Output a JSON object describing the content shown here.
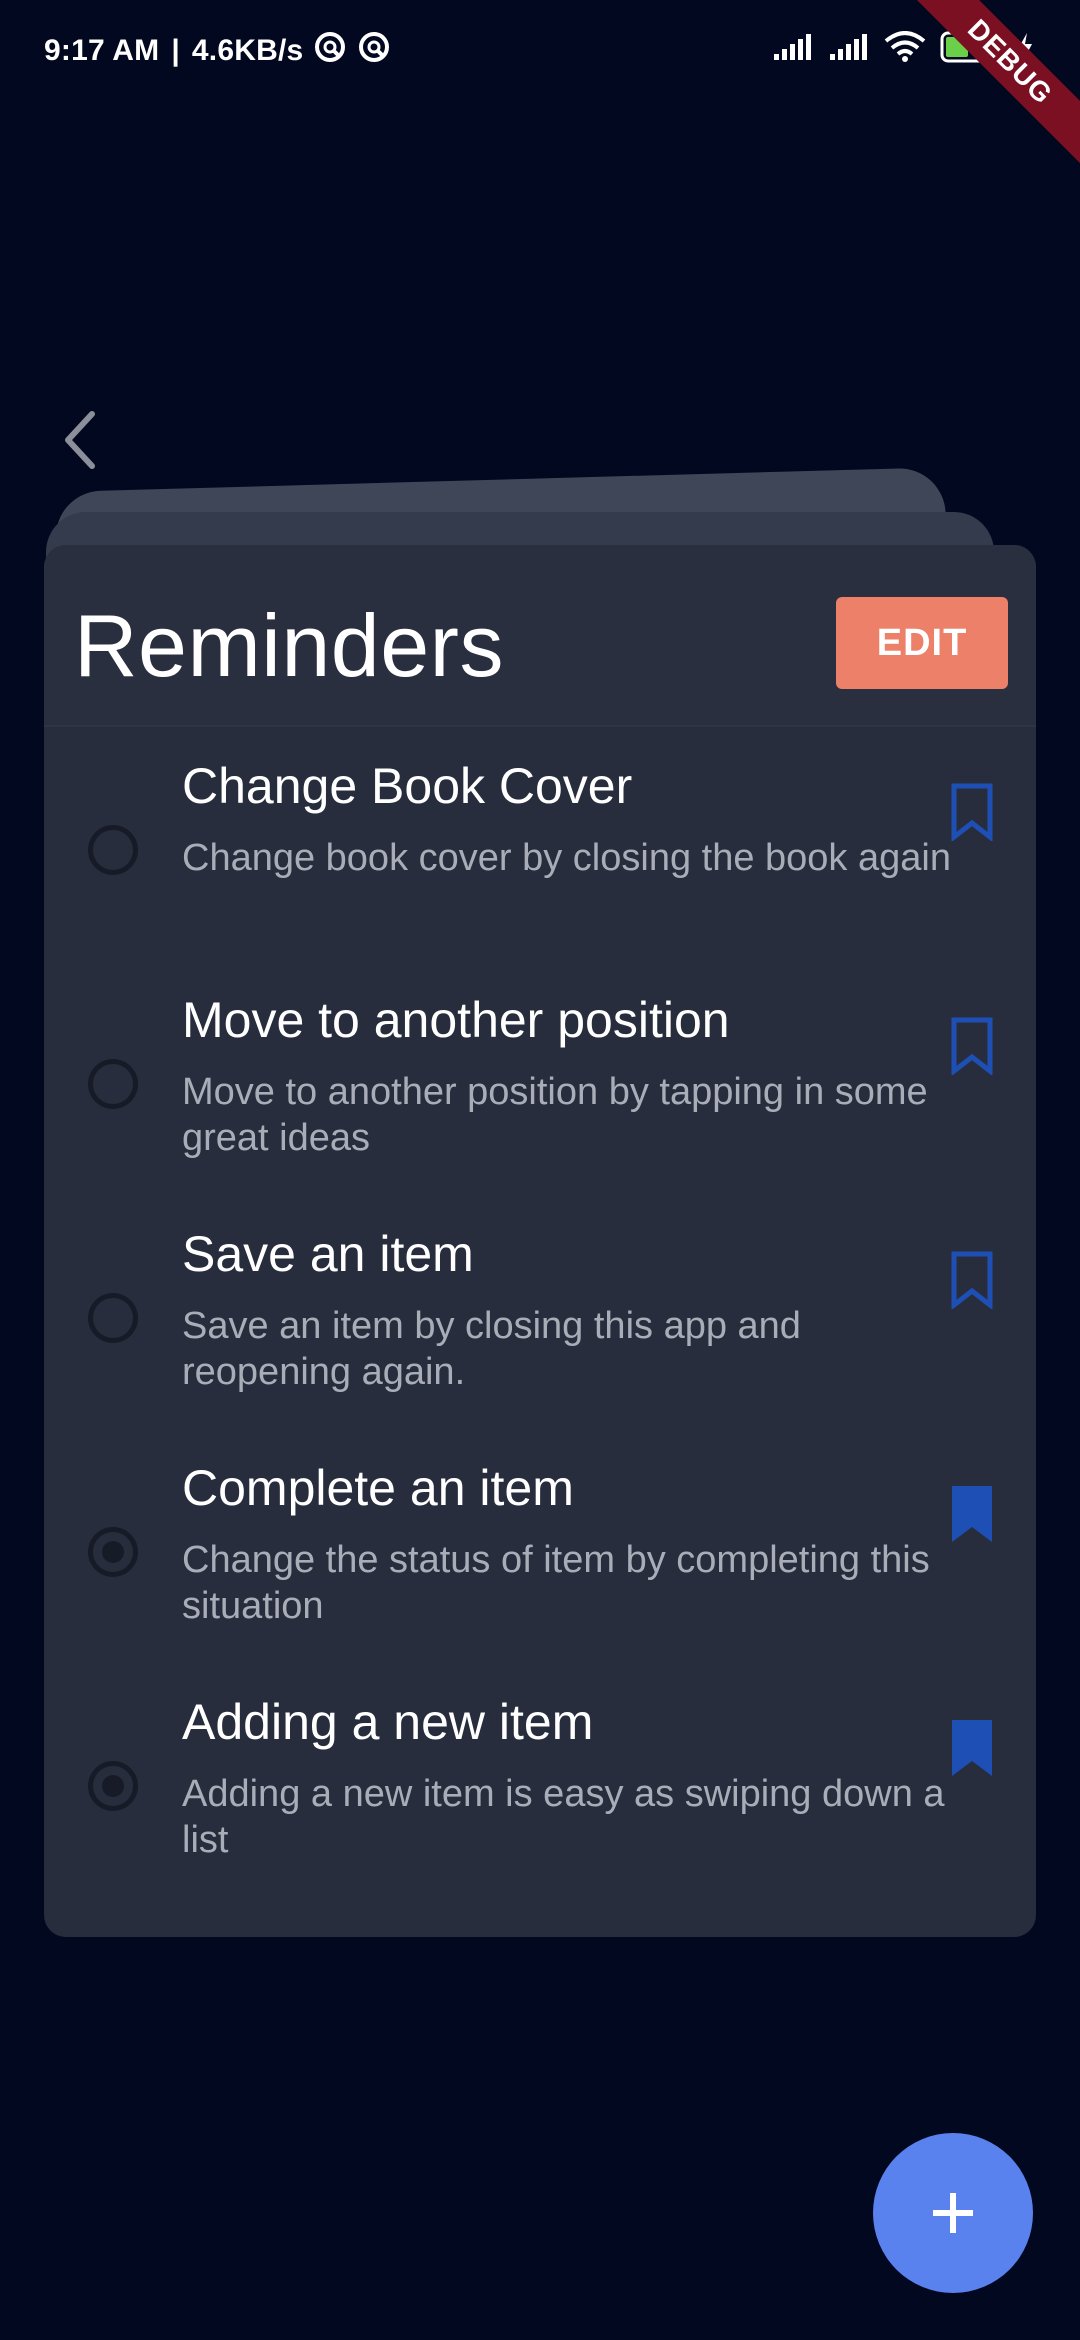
{
  "status_bar": {
    "time": "9:17 AM",
    "separator": "|",
    "network_speed": "4.6KB/s",
    "battery_level": "47",
    "debug_label": "DEBUG"
  },
  "header": {
    "title": "Reminders",
    "edit_label": "EDIT"
  },
  "reminders": [
    {
      "title": "Change Book Cover",
      "description": "Change book cover by closing the book again",
      "completed": false,
      "bookmarked": false
    },
    {
      "title": "Move to another position",
      "description": "Move to another position by tapping in some great ideas",
      "completed": false,
      "bookmarked": false
    },
    {
      "title": "Save an item",
      "description": "Save an item by closing this app and reopening again.",
      "completed": false,
      "bookmarked": false
    },
    {
      "title": "Complete an item",
      "description": "Change the status of item by completing this situation",
      "completed": true,
      "bookmarked": true
    },
    {
      "title": "Adding a new item",
      "description": "Adding a new item is easy as swiping down a list",
      "completed": true,
      "bookmarked": true
    }
  ],
  "fab": {
    "icon": "plus-icon"
  },
  "colors": {
    "background": "#020820",
    "card": "#282d3d",
    "accent_edit": "#ed8068",
    "bookmark_blue": "#1e4fb5",
    "fab_blue": "#5a82ef"
  }
}
